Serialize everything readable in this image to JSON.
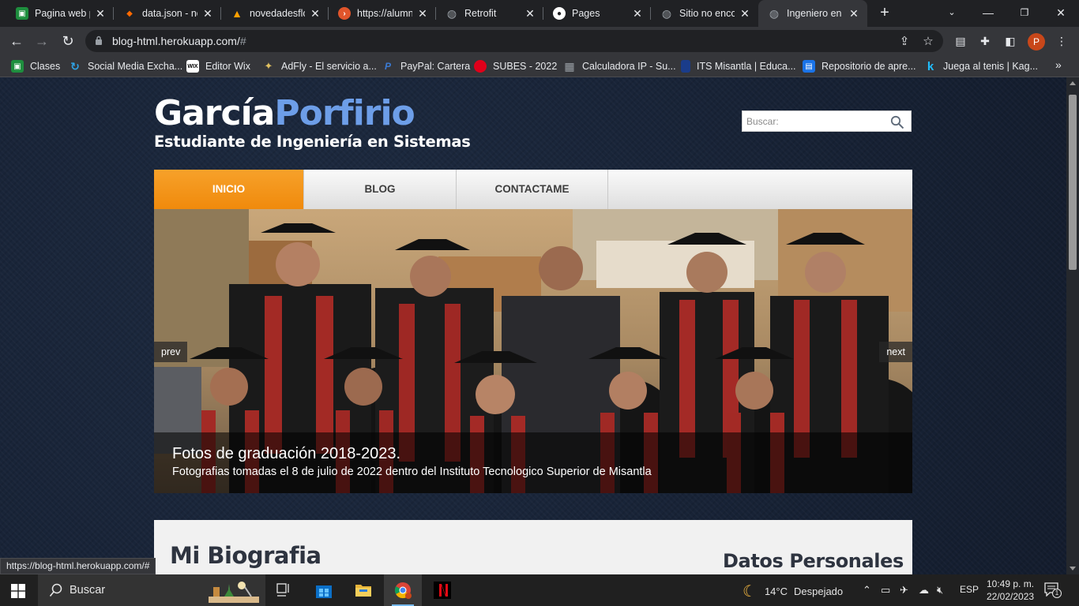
{
  "browser": {
    "tabs": [
      {
        "title": "Pagina web p",
        "favicon": "google-classroom",
        "color": "#1e8e3e",
        "active": false
      },
      {
        "title": "data.json - no",
        "favicon": "codesandbox",
        "color": "#ff6a00",
        "active": false
      },
      {
        "title": "novedadesflo",
        "favicon": "firebase",
        "color": "#ffa000",
        "active": false
      },
      {
        "title": "https://alumn",
        "favicon": "orange-circle",
        "color": "#e1552b",
        "active": false
      },
      {
        "title": "Retrofit",
        "favicon": "globe",
        "color": "#9aa0a6",
        "active": false
      },
      {
        "title": "Pages",
        "favicon": "github",
        "color": "#ffffff",
        "active": false
      },
      {
        "title": "Sitio no encon",
        "favicon": "globe",
        "color": "#9aa0a6",
        "active": false
      },
      {
        "title": "Ingeniero en",
        "favicon": "globe",
        "color": "#9aa0a6",
        "active": true
      }
    ],
    "url_host": "blog-html.herokuapp.com/",
    "url_path": "#",
    "profile_initial": "P",
    "bookmarks": [
      {
        "label": "Clases",
        "icon": "google-classroom",
        "color": "#1e8e3e"
      },
      {
        "label": "Social Media Excha...",
        "icon": "loop",
        "color": "#2fa4e7"
      },
      {
        "label": "Editor Wix",
        "icon": "wix",
        "color": "#ffffff"
      },
      {
        "label": "AdFly - El servicio a...",
        "icon": "adfly",
        "color": "#e0c060"
      },
      {
        "label": "PayPal: Cartera",
        "icon": "paypal",
        "color": "#0070ba"
      },
      {
        "label": "SUBES - 2022",
        "icon": "red-dot",
        "color": "#e0001a"
      },
      {
        "label": "Calculadora IP - Su...",
        "icon": "calculator",
        "color": "#9aa0a6"
      },
      {
        "label": "ITS Misantla | Educa...",
        "icon": "its",
        "color": "#1a3c8a"
      },
      {
        "label": "Repositorio de apre...",
        "icon": "repository",
        "color": "#1a73e8"
      },
      {
        "label": "Juega al tenis | Kag...",
        "icon": "kaggle",
        "color": "#20beff"
      }
    ],
    "status_url": "https://blog-html.herokuapp.com/#"
  },
  "site": {
    "logo_first": "García",
    "logo_second": "Porfirio",
    "tagline": "Estudiante de Ingeniería en Sistemas",
    "search_placeholder": "Buscar:",
    "menu": [
      "INICIO",
      "BLOG",
      "CONTACTAME"
    ],
    "active_menu": "INICIO",
    "slider": {
      "title": "Fotos de graduación 2018-2023.",
      "subtitle": "Fotografias tomadas el 8 de julio de 2022 dentro del Instituto Tecnologico Superior de Misantla",
      "prev": "prev",
      "next": "next"
    },
    "section_title": "Mi Biografia",
    "sidebar_title": "Datos Personales"
  },
  "taskbar": {
    "search_label": "Buscar",
    "weather_temp": "14°C",
    "weather_desc": "Despejado",
    "language": "ESP",
    "time": "10:49 p. m.",
    "date": "22/02/2023",
    "notification_count": "1"
  }
}
